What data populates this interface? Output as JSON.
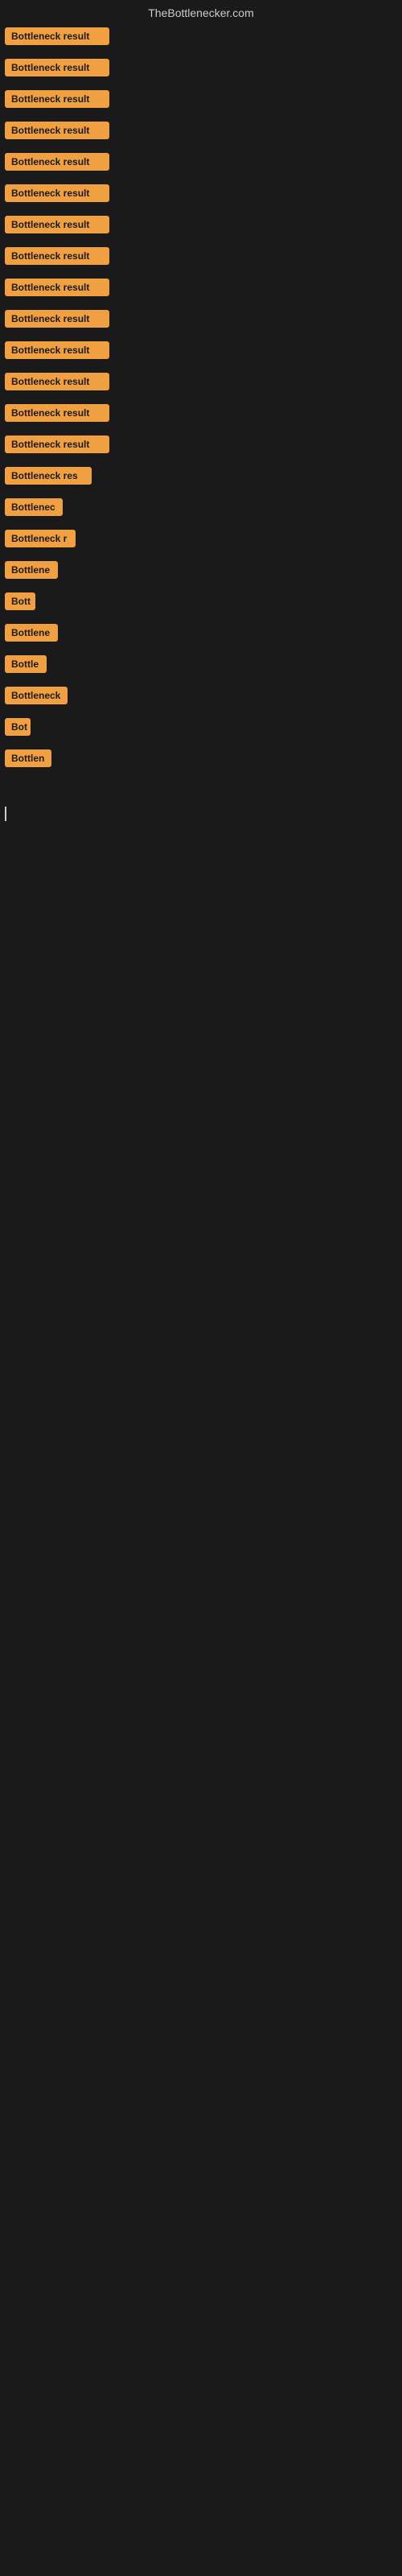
{
  "header": {
    "title": "TheBottlenecker.com"
  },
  "items": [
    {
      "id": 1,
      "label": "Bottleneck result",
      "width": 130
    },
    {
      "id": 2,
      "label": "Bottleneck result",
      "width": 130
    },
    {
      "id": 3,
      "label": "Bottleneck result",
      "width": 130
    },
    {
      "id": 4,
      "label": "Bottleneck result",
      "width": 130
    },
    {
      "id": 5,
      "label": "Bottleneck result",
      "width": 130
    },
    {
      "id": 6,
      "label": "Bottleneck result",
      "width": 130
    },
    {
      "id": 7,
      "label": "Bottleneck result",
      "width": 130
    },
    {
      "id": 8,
      "label": "Bottleneck result",
      "width": 130
    },
    {
      "id": 9,
      "label": "Bottleneck result",
      "width": 130
    },
    {
      "id": 10,
      "label": "Bottleneck result",
      "width": 130
    },
    {
      "id": 11,
      "label": "Bottleneck result",
      "width": 130
    },
    {
      "id": 12,
      "label": "Bottleneck result",
      "width": 130
    },
    {
      "id": 13,
      "label": "Bottleneck result",
      "width": 130
    },
    {
      "id": 14,
      "label": "Bottleneck result",
      "width": 130
    },
    {
      "id": 15,
      "label": "Bottleneck res",
      "width": 108
    },
    {
      "id": 16,
      "label": "Bottlenec",
      "width": 72
    },
    {
      "id": 17,
      "label": "Bottleneck r",
      "width": 88
    },
    {
      "id": 18,
      "label": "Bottlene",
      "width": 66
    },
    {
      "id": 19,
      "label": "Bott",
      "width": 38
    },
    {
      "id": 20,
      "label": "Bottlene",
      "width": 66
    },
    {
      "id": 21,
      "label": "Bottle",
      "width": 52
    },
    {
      "id": 22,
      "label": "Bottleneck",
      "width": 78
    },
    {
      "id": 23,
      "label": "Bot",
      "width": 32
    },
    {
      "id": 24,
      "label": "Bottlen",
      "width": 58
    }
  ],
  "colors": {
    "badge_bg": "#f0a040",
    "badge_text": "#1a1a1a",
    "body_bg": "#1a1a1a",
    "header_text": "#cccccc"
  }
}
